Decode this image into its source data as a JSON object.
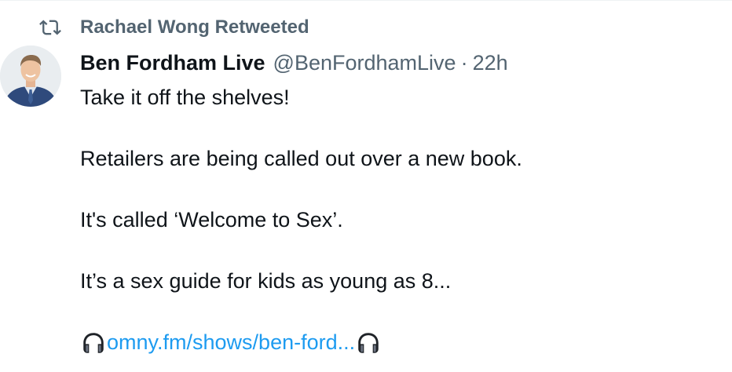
{
  "retweet": {
    "icon": "retweet-icon",
    "label": "Rachael Wong Retweeted"
  },
  "tweet": {
    "avatar_icon": "avatar",
    "display_name": "Ben Fordham Live",
    "handle": "@BenFordhamLive",
    "separator": "·",
    "time": "22h",
    "paragraphs": [
      "Take it off the shelves!",
      "Retailers are being called out over a new book.",
      "It's called ‘Welcome to Sex’.",
      "It’s a sex guide for kids as young as 8..."
    ],
    "link_text": "omny.fm/shows/ben-ford...",
    "link_icon": "headphone-icon"
  },
  "colors": {
    "text": "#0f1419",
    "secondary": "#536471",
    "link": "#1d9bf0",
    "divider": "#eff3f4"
  }
}
